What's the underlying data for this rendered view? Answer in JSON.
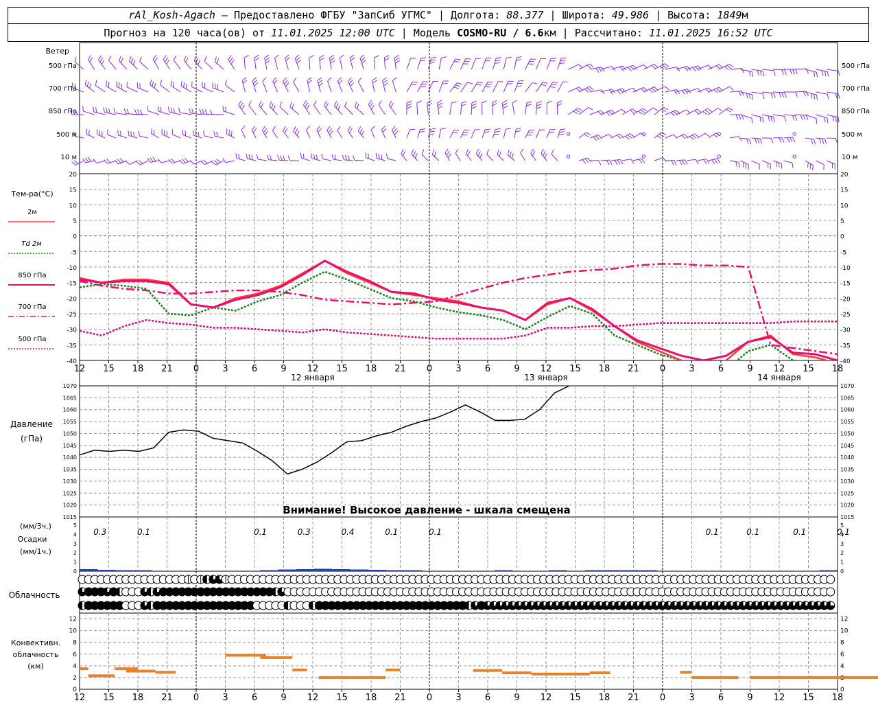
{
  "header": {
    "station": "rAl_Kosh-Agach",
    "provider": "Предоставлено ФГБУ \"ЗапСиб УГМС\"",
    "lon_label": "Долгота:",
    "lon": "88.377",
    "lat_label": "Широта:",
    "lat": "49.986",
    "alt_label": "Высота:",
    "alt": "1849",
    "alt_unit": "м",
    "forecast_label": "Прогноз на 120 часа(ов) от",
    "forecast_start": "11.01.2025 12:00 UTC",
    "model_label": "Модель",
    "model": "COSMO-RU / 6.6",
    "model_unit": "км",
    "computed_label": "Рассчитано:",
    "computed": "11.01.2025 16:52 UTC"
  },
  "chart_data": {
    "type": "line",
    "time_axis": {
      "ticks": [
        "12",
        "15",
        "18",
        "21",
        "0",
        "3",
        "6",
        "9",
        "12",
        "15",
        "18",
        "21",
        "0",
        "3",
        "6",
        "9",
        "12",
        "15",
        "18",
        "21",
        "0",
        "3",
        "6",
        "9",
        "12",
        "15",
        "18"
      ],
      "day_labels": [
        {
          "at_tick": 8,
          "text": "12 января"
        },
        {
          "at_tick": 16,
          "text": "13 января"
        },
        {
          "at_tick": 24,
          "text": "14 января"
        }
      ],
      "midnights": [
        4,
        12,
        20
      ]
    },
    "wind": {
      "label": "Ветер",
      "levels": [
        "500 гПа",
        "700 гПа",
        "850 гПа",
        "500 м",
        "10 м"
      ],
      "color": "#8a2be2"
    },
    "temperature": {
      "label": "Тем-ра(°С)",
      "ylim": [
        -40,
        20
      ],
      "ticks": [
        "20",
        "15",
        "10",
        "5",
        "0",
        "-5",
        "-10",
        "-15",
        "-20",
        "-25",
        "-30",
        "-35",
        "-40"
      ],
      "series": [
        {
          "name": "2м",
          "color": "#ff3b3b",
          "style": "solid",
          "values": [
            -13.5,
            -15,
            -14,
            -14,
            -15,
            -22,
            -23,
            -20,
            -18.5,
            -16,
            -12,
            -8,
            -12,
            -15,
            -18,
            -19,
            -20,
            -21,
            -23,
            -24,
            -27,
            -22,
            -20,
            -24,
            -29,
            -34,
            -37,
            -40,
            -43,
            -40,
            -34,
            -32,
            -38,
            -39,
            -41
          ]
        },
        {
          "name": "Td  2м",
          "color": "#1a7f1a",
          "style": "dotted",
          "values": [
            -16.5,
            -15.5,
            -16,
            -17,
            -25,
            -25.5,
            -23,
            -24,
            -21,
            -19,
            -15,
            -11.5,
            -14,
            -17,
            -20,
            -21,
            -23,
            -24.5,
            -25.5,
            -27,
            -30,
            -26,
            -22.5,
            -25,
            -32,
            -35,
            -38,
            -40,
            -44,
            -43,
            -37,
            -35,
            -40,
            -41,
            -42
          ]
        },
        {
          "name": "850 гПа",
          "color": "#e8106a",
          "style": "solid-thick",
          "values": [
            -14,
            -15,
            -14.5,
            -14.5,
            -15.5,
            -22,
            -23,
            -20.5,
            -19,
            -16.5,
            -12.5,
            -8,
            -11.5,
            -14.5,
            -18,
            -18.5,
            -20.5,
            -21.5,
            -23,
            -24,
            -27,
            -21.5,
            -20,
            -23.5,
            -29,
            -33.5,
            -36,
            -38.5,
            -40,
            -38.5,
            -34,
            -32.5,
            -37.5,
            -38,
            -40
          ]
        },
        {
          "name": "700 гПа",
          "color": "#e8106a",
          "style": "dashdot",
          "values": [
            -14.5,
            -16,
            -17,
            -17.5,
            -18.5,
            -18.5,
            -18,
            -17.5,
            -17.5,
            -18,
            -19,
            -20.5,
            -21,
            -21.5,
            -22,
            -21.5,
            -21,
            -19,
            -17,
            -15,
            -13.5,
            -12.5,
            -11.5,
            -11,
            -10.5,
            -9.5,
            -9,
            -9,
            -9.5,
            -9.5,
            -10,
            -35,
            -36,
            -37,
            -38
          ]
        },
        {
          "name": "500 гПа",
          "color": "#d0106e",
          "style": "dotted",
          "values": [
            -30.5,
            -32,
            -29,
            -27,
            -28,
            -28.5,
            -29.5,
            -29.5,
            -30,
            -30.5,
            -31,
            -30,
            -31,
            -31.5,
            -32,
            -32.5,
            -33,
            -33,
            -33,
            -33,
            -32,
            -29.5,
            -29.5,
            -29,
            -29,
            -28.5,
            -28,
            -28,
            -28,
            -28,
            -28,
            -28,
            -27.5,
            -27.5,
            -27.5
          ]
        }
      ]
    },
    "pressure": {
      "label": "Давление",
      "unit": "(гПа)",
      "ylim": [
        1015,
        1070
      ],
      "ticks": [
        "1070",
        "1065",
        "1060",
        "1055",
        "1050",
        "1045",
        "1040",
        "1035",
        "1030",
        "1025",
        "1020",
        "1015"
      ],
      "warning": "Внимание! Высокое давление - шкала смещена",
      "values": [
        1041,
        1043,
        1042.5,
        1043,
        1042.5,
        1044,
        1050.5,
        1051.5,
        1051,
        1048,
        1047,
        1046,
        1042.5,
        1038.5,
        1033,
        1035,
        1038,
        1042,
        1046.5,
        1047,
        1049,
        1050.5,
        1053,
        1055,
        1056.5,
        1059,
        1062,
        1059,
        1055.5,
        1055.5,
        1056,
        1060,
        1067,
        1070
      ]
    },
    "precipitation": {
      "label": "Осадки",
      "unit_top": "(мм/3ч.)",
      "unit_bottom": "(мм/1ч.)",
      "ylim": [
        0,
        5
      ],
      "ticks": [
        "5",
        "4",
        "3",
        "2",
        "1",
        "0"
      ],
      "labels": [
        {
          "at": 0.7,
          "text": "0.3"
        },
        {
          "at": 2.2,
          "text": "0.1"
        },
        {
          "at": 6.2,
          "text": "0.1"
        },
        {
          "at": 7.7,
          "text": "0.3"
        },
        {
          "at": 9.2,
          "text": "0.4"
        },
        {
          "at": 10.7,
          "text": "0.1"
        },
        {
          "at": 12.2,
          "text": "0.1"
        },
        {
          "at": 21.7,
          "text": "0.1"
        },
        {
          "at": 23.1,
          "text": "0.1"
        },
        {
          "at": 24.7,
          "text": "0.1"
        },
        {
          "at": 26.2,
          "text": "0.1"
        }
      ],
      "hourly_color": "#1f3fd0",
      "hourly": [
        0.3,
        0.2,
        0.15,
        0.1,
        0,
        0,
        0,
        0,
        0,
        0,
        0.1,
        0.25,
        0.3,
        0.35,
        0.3,
        0.25,
        0.2,
        0.1,
        0.05,
        0,
        0,
        0,
        0,
        0.05,
        0,
        0,
        0.05,
        0,
        0.05,
        0.05,
        0.05,
        0.05,
        0,
        0,
        0,
        0,
        0,
        0,
        0,
        0,
        0,
        0.05
      ]
    },
    "cloudiness": {
      "label": "Облачность",
      "rows": [
        [
          0,
          0,
          0,
          0,
          0,
          0,
          0,
          0,
          0,
          0,
          0,
          0,
          0,
          0,
          0,
          0,
          0,
          1,
          0,
          1,
          2,
          3,
          3,
          1,
          0,
          0,
          0,
          0,
          0,
          0,
          0,
          0,
          0,
          0,
          0,
          0,
          0,
          0,
          0,
          0,
          0,
          0,
          0,
          0,
          0,
          0,
          0,
          0,
          0,
          0,
          0,
          0,
          0,
          0,
          0,
          0,
          0,
          0,
          0,
          0,
          0,
          0,
          0,
          0,
          0,
          0,
          0,
          0,
          0,
          0,
          0,
          0,
          0,
          0,
          0,
          0,
          0,
          0,
          0,
          0,
          0,
          0,
          0,
          0,
          0,
          0,
          0,
          0,
          0,
          0,
          0,
          0,
          0,
          0,
          0,
          0,
          0,
          0,
          0,
          0,
          0,
          0,
          0,
          0,
          0,
          0,
          0,
          0,
          0,
          0,
          0,
          0,
          0,
          0,
          0,
          0,
          0,
          0,
          0,
          0,
          0,
          0,
          0,
          0,
          0
        ],
        [
          3,
          4,
          4,
          4,
          3,
          4,
          2,
          0,
          0,
          0,
          3,
          2,
          3,
          4,
          4,
          4,
          4,
          4,
          4,
          4,
          4,
          4,
          4,
          4,
          4,
          4,
          4,
          4,
          4,
          4,
          4,
          2,
          3,
          0,
          0,
          0,
          0,
          0,
          0,
          0,
          0,
          0,
          0,
          0,
          0,
          0,
          0,
          0,
          0,
          0,
          0,
          0,
          0,
          0,
          0,
          0,
          0,
          0,
          0,
          0,
          0,
          0,
          0,
          0,
          0,
          0,
          0,
          0,
          0,
          0,
          0,
          0,
          0,
          0,
          0,
          0,
          0,
          0,
          0,
          0,
          0,
          0,
          0,
          0,
          0,
          0,
          0,
          0,
          0,
          0,
          0,
          0,
          0,
          0,
          0,
          0,
          0,
          0,
          0,
          0,
          0,
          0,
          0,
          0,
          0,
          0,
          0,
          0,
          0,
          0,
          0,
          0,
          0,
          0,
          0,
          0,
          0,
          0,
          0,
          0,
          0,
          0,
          0,
          0,
          0
        ],
        [
          2,
          4,
          4,
          4,
          4,
          4,
          4,
          0,
          0,
          0,
          3,
          2,
          4,
          4,
          4,
          4,
          4,
          4,
          4,
          4,
          4,
          4,
          4,
          4,
          4,
          4,
          4,
          4,
          0,
          0,
          0,
          0,
          0,
          2,
          0,
          0,
          0,
          2,
          4,
          4,
          4,
          4,
          4,
          4,
          4,
          4,
          4,
          4,
          4,
          4,
          4,
          4,
          4,
          4,
          4,
          4,
          4,
          4,
          4,
          4,
          4,
          4,
          2,
          3,
          4,
          3,
          3,
          3,
          3,
          3,
          3,
          3,
          3,
          3,
          3,
          3,
          3,
          3,
          3,
          3,
          3,
          3,
          3,
          3,
          3,
          3,
          3,
          3,
          3,
          3,
          3,
          3,
          3,
          3,
          3,
          3,
          3,
          3,
          3,
          3,
          3,
          3,
          3,
          3,
          3,
          3,
          3,
          3,
          3,
          3,
          3,
          3,
          3,
          3,
          3,
          3,
          3,
          3,
          3,
          3,
          3,
          3,
          3,
          3,
          2
        ]
      ]
    },
    "convective": {
      "label_lines": [
        "Конвективн.",
        "облачность",
        "(км)"
      ],
      "ylim": [
        0,
        13
      ],
      "ticks": [
        "12",
        "10",
        "8",
        "6",
        "4",
        "2",
        "0"
      ],
      "color": "#e8822a",
      "segments": [
        {
          "t0": 0,
          "t1": 0.3,
          "km": 3.5
        },
        {
          "t0": 0.3,
          "t1": 1.2,
          "km": 2.3
        },
        {
          "t0": 1.2,
          "t1": 2,
          "km": 3.5
        },
        {
          "t0": 1.6,
          "t1": 2.6,
          "km": 3.1
        },
        {
          "t0": 2.6,
          "t1": 3.3,
          "km": 2.9
        },
        {
          "t0": 5.0,
          "t1": 6.4,
          "km": 5.8
        },
        {
          "t0": 6.2,
          "t1": 7.3,
          "km": 5.4
        },
        {
          "t0": 7.3,
          "t1": 7.8,
          "km": 3.3
        },
        {
          "t0": 8.2,
          "t1": 10.5,
          "km": 2.0
        },
        {
          "t0": 10.5,
          "t1": 11.0,
          "km": 3.3
        },
        {
          "t0": 13.5,
          "t1": 14.5,
          "km": 3.2
        },
        {
          "t0": 14.5,
          "t1": 15.5,
          "km": 2.8
        },
        {
          "t0": 15.5,
          "t1": 17.5,
          "km": 2.6
        },
        {
          "t0": 17.5,
          "t1": 18.2,
          "km": 2.8
        },
        {
          "t0": 20.6,
          "t1": 21.0,
          "km": 2.9
        },
        {
          "t0": 21.0,
          "t1": 22.6,
          "km": 2.0
        },
        {
          "t0": 23.0,
          "t1": 25.5,
          "km": 2.0
        },
        {
          "t0": 25.5,
          "t1": 27.5,
          "km": 2.0
        }
      ]
    }
  }
}
